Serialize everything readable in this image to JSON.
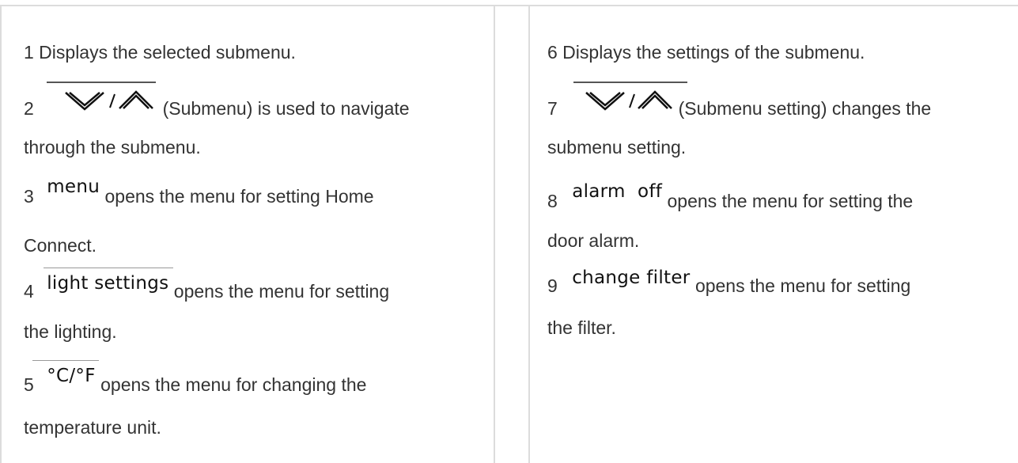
{
  "left": {
    "item1": {
      "text": "1 Displays the selected submenu."
    },
    "item2": {
      "num": "2",
      "rest": "(Submenu) is used to navigate",
      "line2": "through the submenu.",
      "icon": "chevron-down-up-icon"
    },
    "item3": {
      "num": "3",
      "key": "menu",
      "rest": "opens the menu for setting Home",
      "line2": "Connect."
    },
    "item4": {
      "num": "4",
      "key": "light settings",
      "rest": "opens the menu for setting",
      "line2": "the lighting."
    },
    "item5": {
      "num": "5",
      "key": "°C/°F",
      "rest": "opens the menu for changing the",
      "line2": "temperature unit."
    }
  },
  "right": {
    "item6": {
      "text": "6 Displays the settings of the submenu."
    },
    "item7": {
      "num": "7",
      "rest": "(Submenu setting) changes the",
      "line2": "submenu setting.",
      "icon": "chevron-down-up-icon"
    },
    "item8": {
      "num": "8",
      "key": "alarm  off",
      "rest": "opens the menu for setting the",
      "line2": "door alarm."
    },
    "item9": {
      "num": "9",
      "key": "change filter",
      "rest": "opens the menu for setting",
      "line2": "the filter."
    }
  }
}
